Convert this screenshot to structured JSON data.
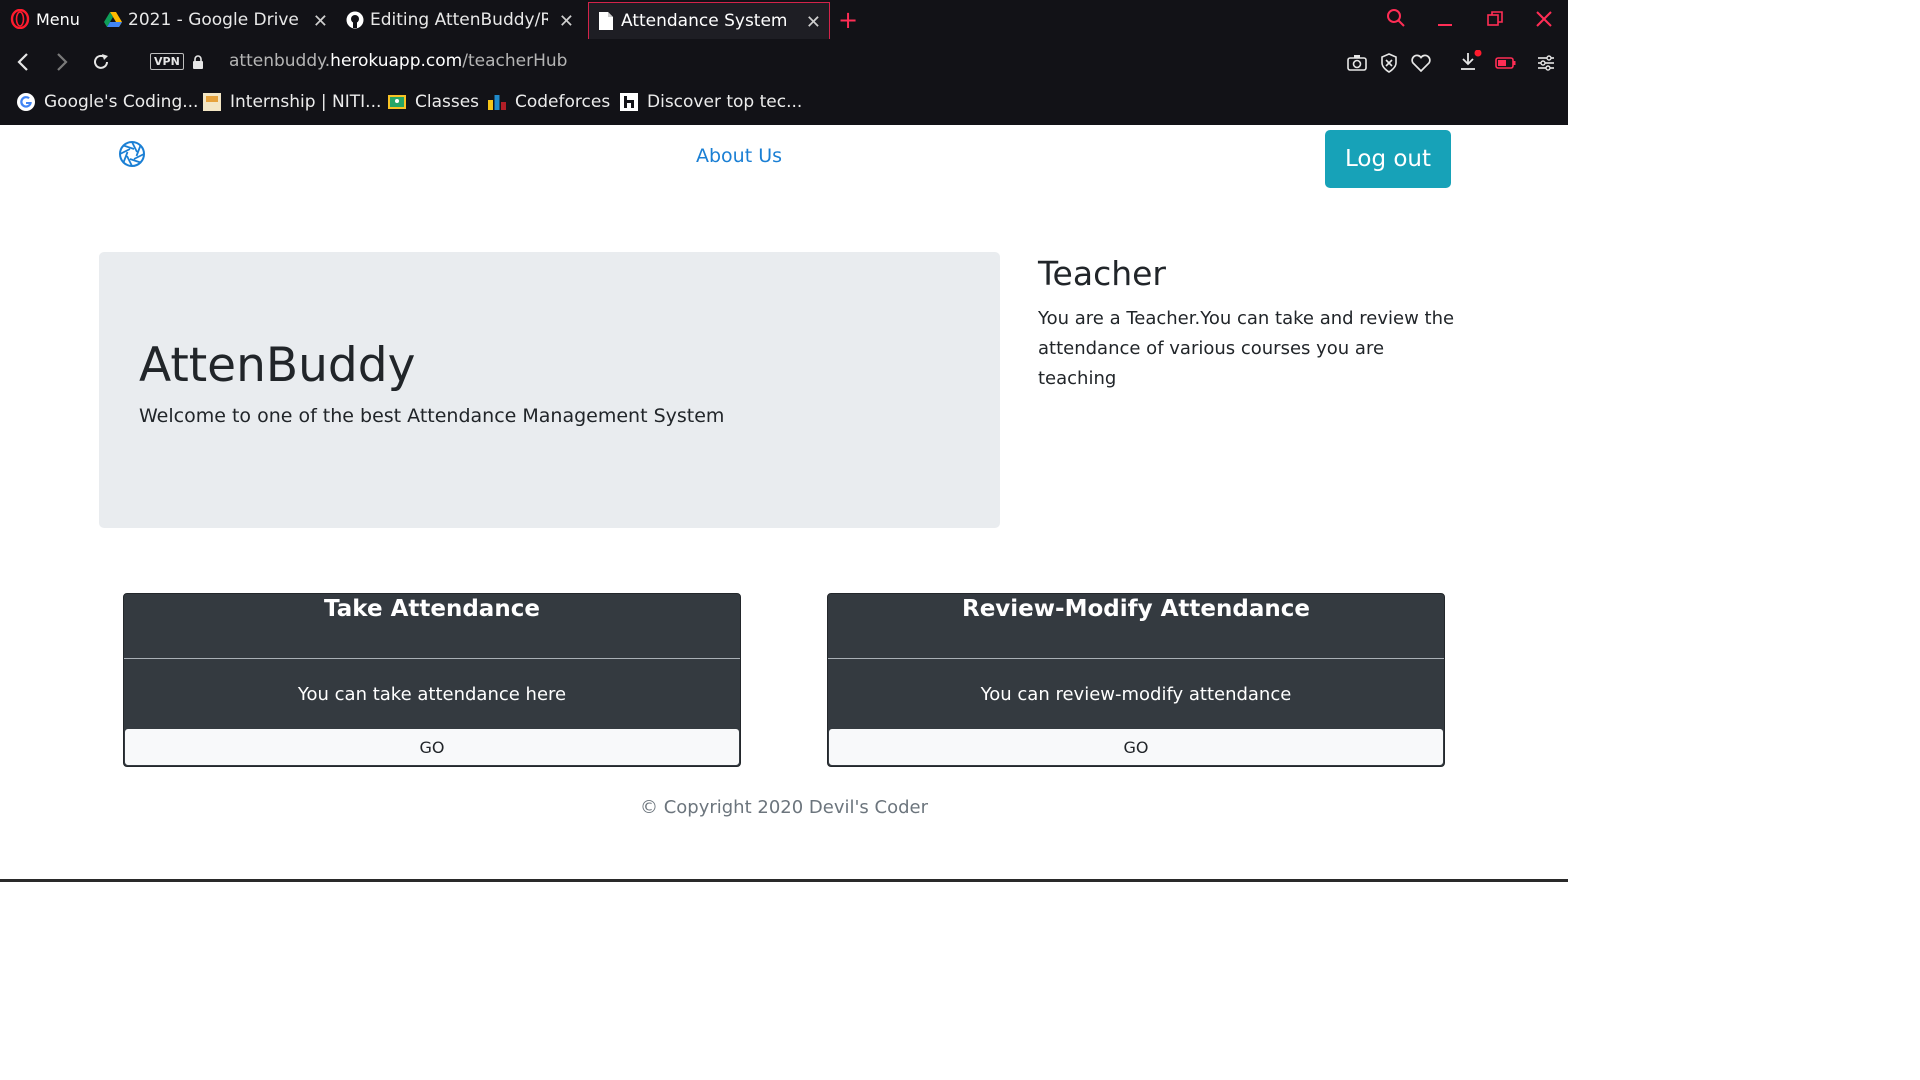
{
  "browser": {
    "menu_label": "Menu",
    "tabs": [
      {
        "title": "2021 - Google Drive",
        "close": "✕"
      },
      {
        "title": "Editing AttenBuddy/README",
        "close": "✕"
      },
      {
        "title": "Attendance System",
        "close": "✕"
      }
    ],
    "new_tab": "+",
    "url_prefix": "attenbuddy.",
    "url_domain": "herokuapp.com",
    "url_path": "/teacherHub",
    "vpn_label": "VPN",
    "bookmarks": [
      {
        "label": "Google's Coding..."
      },
      {
        "label": "Internship | NITI..."
      },
      {
        "label": "Classes"
      },
      {
        "label": "Codeforces"
      },
      {
        "label": "Discover top tec..."
      }
    ],
    "accent_color": "#ff2d55"
  },
  "nav": {
    "about_label": "About Us",
    "logout_label": "Log out"
  },
  "jumbotron": {
    "title": "AttenBuddy",
    "subtitle": "Welcome to one of the best Attendance Management System"
  },
  "role": {
    "title": "Teacher",
    "description": "You are a Teacher.You can take and review the attendance of various courses you are teaching"
  },
  "cards": [
    {
      "title": "Take Attendance",
      "text": "You can take attendance here",
      "button": "GO"
    },
    {
      "title": "Review-Modify Attendance",
      "text": "You can review-modify attendance",
      "button": "GO"
    }
  ],
  "footer": {
    "text": "© Copyright 2020 Devil's Coder"
  }
}
